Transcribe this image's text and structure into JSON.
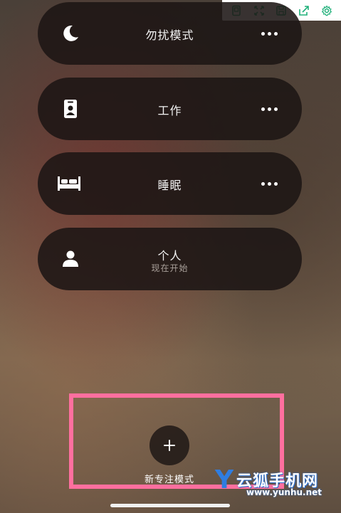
{
  "toolbar": {
    "icons": [
      "tablet-icon",
      "fullscreen-icon",
      "save-icon",
      "share-icon",
      "settings-icon"
    ],
    "icon_color": "#20b07a"
  },
  "focus_modes": [
    {
      "label": "勿扰模式",
      "icon": "moon-icon",
      "has_more": true
    },
    {
      "label": "工作",
      "icon": "id-badge-icon",
      "has_more": true
    },
    {
      "label": "睡眠",
      "icon": "bed-icon",
      "has_more": true
    },
    {
      "label": "个人",
      "sublabel": "现在开始",
      "icon": "person-icon",
      "has_more": false
    }
  ],
  "new_focus": {
    "label": "新专注模式",
    "icon": "plus-icon"
  },
  "watermark": {
    "y": "Y",
    "text": "云狐手机网",
    "url": "www.yunhu.net"
  },
  "colors": {
    "highlight": "#ff6f9f",
    "card_bg": "#1c1614"
  }
}
